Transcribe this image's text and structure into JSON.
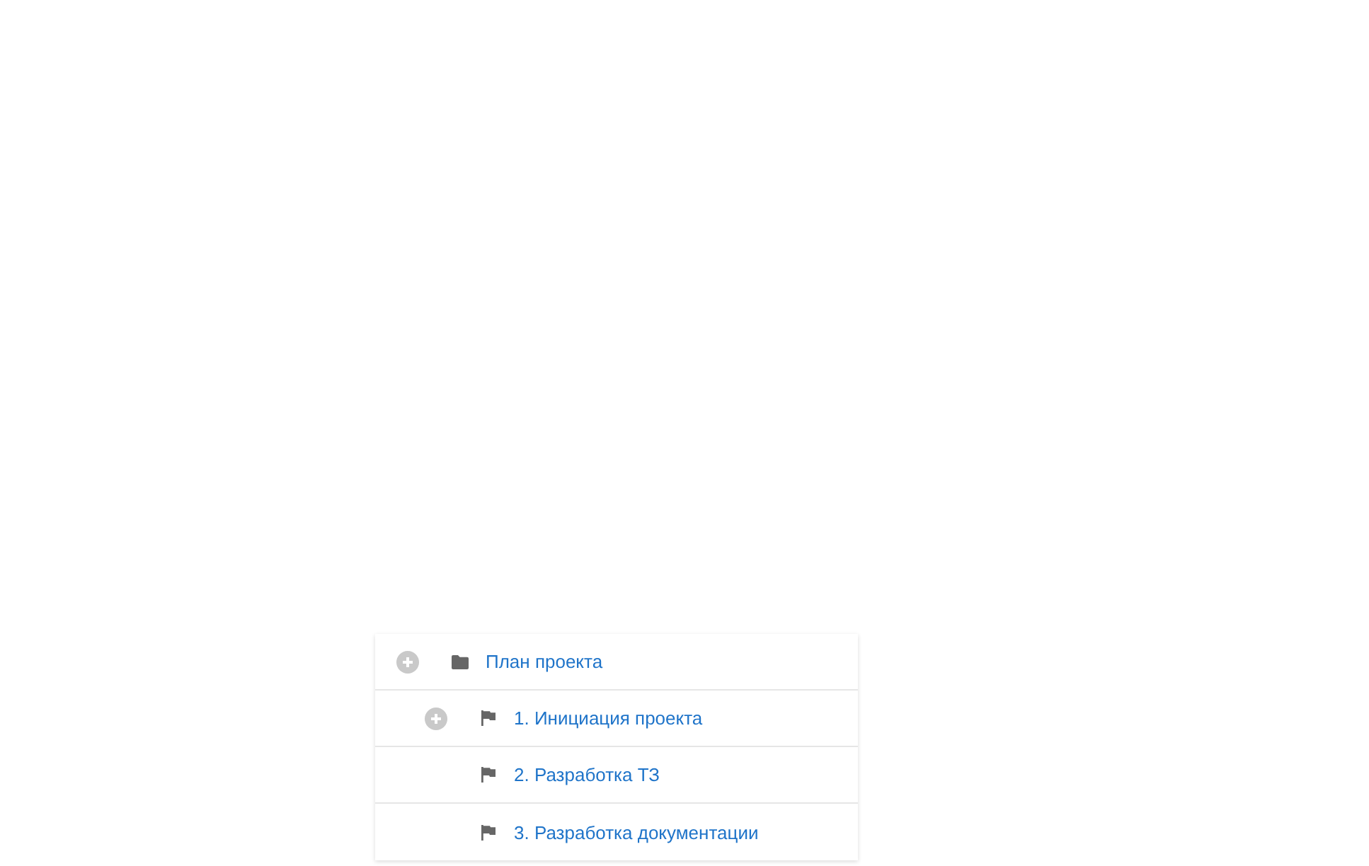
{
  "tree": {
    "nodes": [
      {
        "label": "План проекта",
        "kind": "folder",
        "expandable": true,
        "children": [
          {
            "label": "1. Инициация проекта",
            "kind": "flag",
            "expandable": true
          },
          {
            "label": "2. Разработка ТЗ",
            "kind": "flag",
            "expandable": false
          },
          {
            "label": "3. Разработка документации",
            "kind": "flag",
            "expandable": false
          }
        ]
      }
    ]
  }
}
